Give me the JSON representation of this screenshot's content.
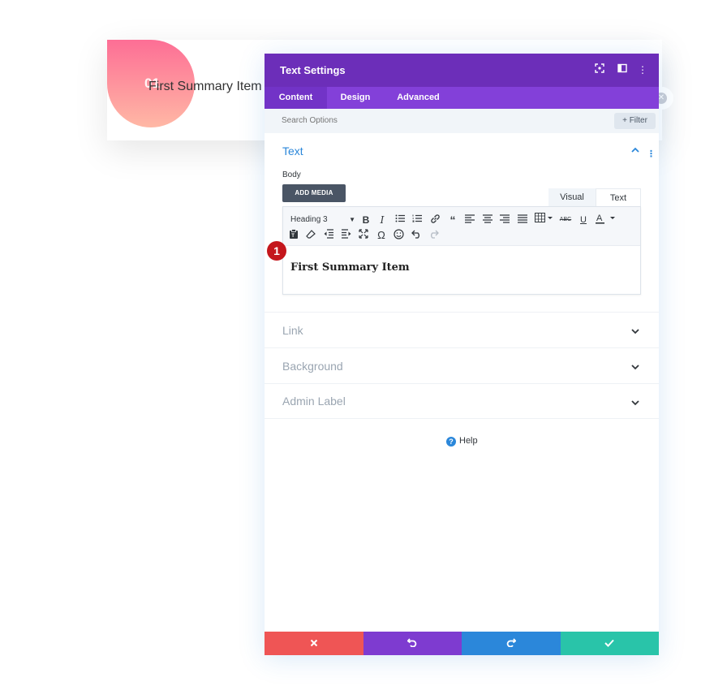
{
  "module": {
    "number": "01",
    "text": "First Summary Item"
  },
  "modal": {
    "title": "Text Settings",
    "tabs": [
      {
        "label": "Content"
      },
      {
        "label": "Design"
      },
      {
        "label": "Advanced"
      }
    ],
    "search_placeholder": "Search Options",
    "filter_label": "+ Filter",
    "text_section": {
      "title": "Text",
      "body_label": "Body",
      "add_media_label": "ADD MEDIA",
      "visual_tab": "Visual",
      "text_tab": "Text",
      "heading_select_value": "Heading 3",
      "editor_content": "First Summary Item"
    },
    "sections": [
      {
        "title": "Link"
      },
      {
        "title": "Background"
      },
      {
        "title": "Admin Label"
      }
    ],
    "help_label": "Help"
  },
  "badge": {
    "value": "1"
  },
  "colors": {
    "header": "#6c2eb9",
    "tabs": "#8340d9",
    "accent_blue": "#2b87da",
    "cancel": "#ef5555",
    "undo": "#7e3bd0",
    "redo": "#2b87da",
    "save": "#29c4a9",
    "badge": "#c4161c"
  },
  "icons": {
    "header": [
      "focus-icon",
      "split-view-icon",
      "more-vertical-icon"
    ],
    "footer": [
      "close-icon",
      "undo-icon",
      "redo-icon",
      "check-icon"
    ]
  }
}
